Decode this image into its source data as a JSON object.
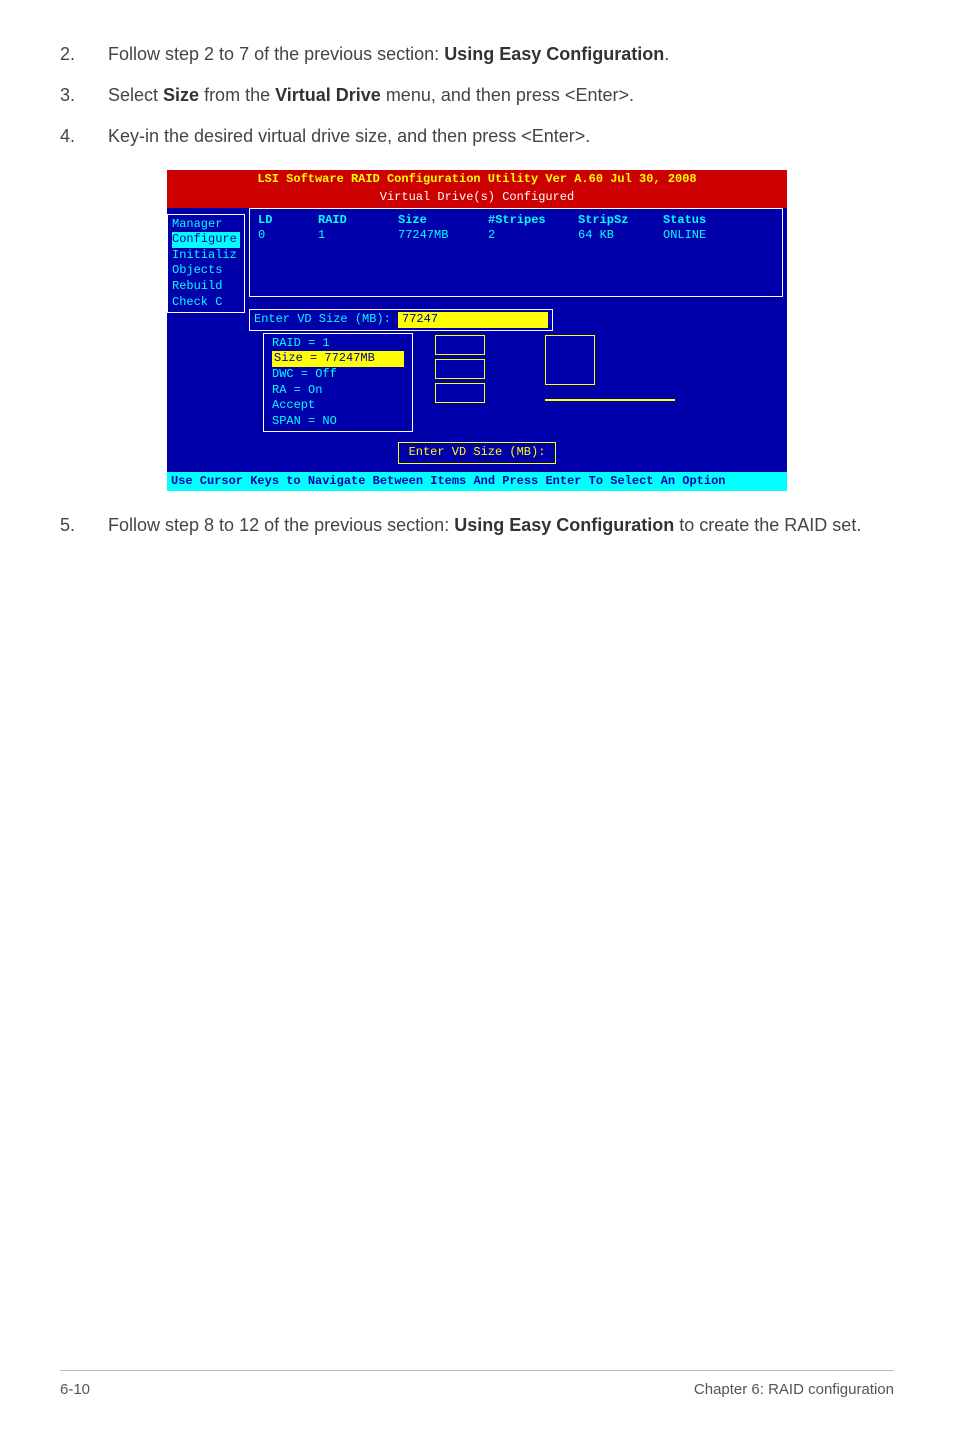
{
  "steps_top": [
    {
      "num": "2.",
      "parts": [
        {
          "text": "Follow step 2 to 7 of the previous section: "
        },
        {
          "text": "Using Easy Configuration",
          "bold": true
        },
        {
          "text": "."
        }
      ]
    },
    {
      "num": "3.",
      "parts": [
        {
          "text": "Select "
        },
        {
          "text": "Size",
          "bold": true
        },
        {
          "text": " from the "
        },
        {
          "text": "Virtual Drive",
          "bold": true
        },
        {
          "text": " menu, and then press <Enter>."
        }
      ]
    },
    {
      "num": "4.",
      "parts": [
        {
          "text": "Key-in the desired virtual drive size, and then press <Enter>."
        }
      ]
    }
  ],
  "steps_bottom": [
    {
      "num": "5.",
      "parts": [
        {
          "text": "Follow step 8 to 12 of the previous section: "
        },
        {
          "text": "Using Easy Configuration",
          "bold": true
        },
        {
          "text": " to create the RAID set."
        }
      ]
    }
  ],
  "bios": {
    "title": "LSI Software RAID Configuration Utility Ver A.60 Jul 30, 2008",
    "subtitle": "Virtual Drive(s) Configured",
    "table": {
      "headers": [
        "LD",
        "RAID",
        "Size",
        "#Stripes",
        "StripSz",
        "Status"
      ],
      "row": [
        "0",
        "1",
        "77247MB",
        "2",
        "64 KB",
        "ONLINE"
      ]
    },
    "left_menu": [
      "Manager",
      "Configure",
      "Initializ",
      "Objects",
      "Rebuild",
      "Check C"
    ],
    "input_label": "Enter VD Size (MB):",
    "input_value": "77247",
    "props": [
      {
        "label": "RAID = 1",
        "sel": false
      },
      {
        "label": "Size = 77247MB",
        "sel": true
      },
      {
        "label": "DWC  = Off",
        "sel": false
      },
      {
        "label": "RA   = On",
        "sel": false
      },
      {
        "label": "Accept",
        "sel": false
      },
      {
        "label": "SPAN = NO",
        "sel": false
      }
    ],
    "prompt": "Enter VD Size (MB):",
    "footer": "Use Cursor Keys to Navigate Between Items And Press Enter To Select An Option"
  },
  "footer": {
    "page": "6-10",
    "chapter": "Chapter 6: RAID configuration"
  }
}
